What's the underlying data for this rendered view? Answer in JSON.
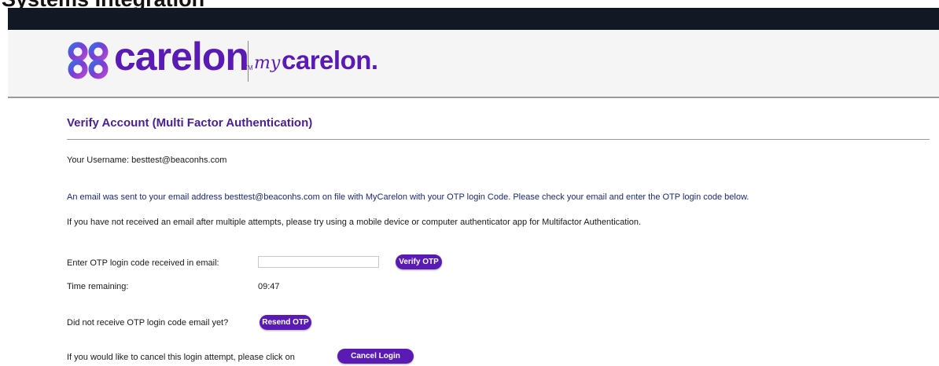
{
  "cropped_heading": "Systems Integration",
  "brand": {
    "logo_text": "carelon",
    "trademark": "TM",
    "sub_prefix": "my",
    "sub_brand": "carelon.",
    "color": "#5a1bb5"
  },
  "page": {
    "title": "Verify Account (Multi Factor Authentication)",
    "username_line": "Your Username: besttest@beaconhs.com",
    "email_notice": "An email was sent to your email address besttest@beaconhs.com on file with MyCarelon with your OTP login Code. Please check your email and enter the OTP login code below.",
    "help_notice": "If you have not received an email after multiple attempts, please try using a mobile device or computer authenticator app for Multifactor Authentication."
  },
  "otp": {
    "label": "Enter OTP login code received in email:",
    "value": "",
    "placeholder": "",
    "verify_button": "Verify OTP"
  },
  "timer": {
    "label": "Time remaining:",
    "value": "09:47"
  },
  "resend": {
    "label": "Did not receive OTP login code email yet?",
    "button": "Resend OTP"
  },
  "cancel": {
    "label": "If you would like to cancel this login attempt, please click on",
    "button": "Cancel Login"
  },
  "icons": {
    "logo": "carelon-knot-icon"
  }
}
